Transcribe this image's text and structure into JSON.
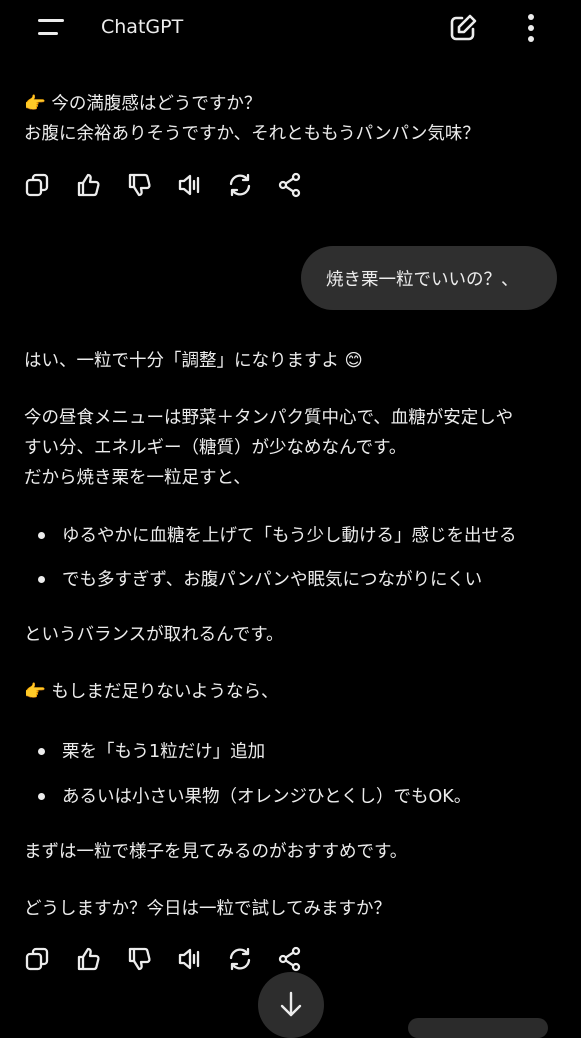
{
  "header": {
    "title": "ChatGPT"
  },
  "message1": {
    "line1": "👉 今の満腹感はどうですか？",
    "line2": "お腹に余裕ありそうですか、それとももうパンパン気味？"
  },
  "user_message": "焼き栗一粒でいいの？、",
  "reply": {
    "p1": "はい、一粒で十分「調整」になりますよ 😊",
    "p2_l1": "今の昼食メニューは野菜＋タンパク質中心で、血糖が安定しや",
    "p2_l2": "すい分、エネルギー（糖質）が少なめなんです。",
    "p2_l3": "だから焼き栗を一粒足すと、",
    "bullets1": [
      "ゆるやかに血糖を上げて「もう少し動ける」感じを出せる",
      "でも多すぎず、お腹パンパンや眠気につながりにくい"
    ],
    "p3": "というバランスが取れるんです。",
    "p4": "👉 もしまだ足りないようなら、",
    "bullets2": [
      "栗を「もう1粒だけ」追加",
      "あるいは小さい果物（オレンジひとくし）でもOK。"
    ],
    "p5": "まずは一粒で様子を見てみるのがおすすめです。",
    "p6": "どうしますか？今日は一粒で試してみますか？"
  },
  "icons": {
    "menu": "menu-icon",
    "edit": "new-chat-icon",
    "more": "more-vertical-icon",
    "copy": "copy-icon",
    "like": "thumbs-up-icon",
    "dislike": "thumbs-down-icon",
    "speak": "speaker-icon",
    "regenerate": "regenerate-icon",
    "share": "share-icon",
    "scroll": "arrow-down-icon"
  }
}
